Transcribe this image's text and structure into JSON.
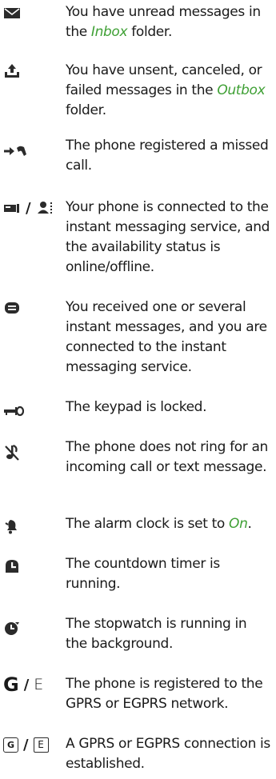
{
  "accent_color": "#3fa035",
  "items": [
    {
      "icon": "envelope-icon",
      "parts": [
        "You have unread messages in the ",
        "Inbox",
        " folder."
      ]
    },
    {
      "icon": "outbox-tray-icon",
      "parts": [
        "You have unsent, canceled, or failed messages in the ",
        "Outbox",
        " folder."
      ]
    },
    {
      "icon": "missed-call-icon",
      "parts": [
        "The phone registered a missed call.",
        "",
        ""
      ]
    },
    {
      "icon": "instant-messaging-online-offline-icon",
      "separator": "/",
      "parts": [
        "Your phone is connected to the instant messaging service, and the availability status is online/offline.",
        "",
        ""
      ]
    },
    {
      "icon": "instant-message-icon",
      "parts": [
        "You received one or several instant messages, and you are connected to the instant messaging service.",
        "",
        ""
      ]
    },
    {
      "icon": "keypad-lock-icon",
      "parts": [
        "The keypad is locked.",
        "",
        ""
      ]
    },
    {
      "icon": "silent-ringtone-icon",
      "parts": [
        "The phone does not ring for an incoming call or text message.",
        "",
        ""
      ]
    },
    {
      "icon": "alarm-clock-icon",
      "parts": [
        "The alarm clock is set to ",
        "On",
        "."
      ]
    },
    {
      "icon": "countdown-timer-icon",
      "parts": [
        "The countdown timer is running.",
        "",
        ""
      ]
    },
    {
      "icon": "stopwatch-icon",
      "parts": [
        "The stopwatch is running in the background.",
        "",
        ""
      ]
    },
    {
      "icon": "gprs-egprs-registered-icon",
      "separator": "/",
      "glyph_a": "G",
      "glyph_b": "E",
      "parts": [
        "The phone is registered to the GPRS or EGPRS network.",
        "",
        ""
      ]
    },
    {
      "icon": "gprs-egprs-connection-icon",
      "separator": "/",
      "glyph_a": "G",
      "glyph_b": "E",
      "parts": [
        "A GPRS or EGPRS connection is established.",
        "",
        ""
      ]
    }
  ]
}
